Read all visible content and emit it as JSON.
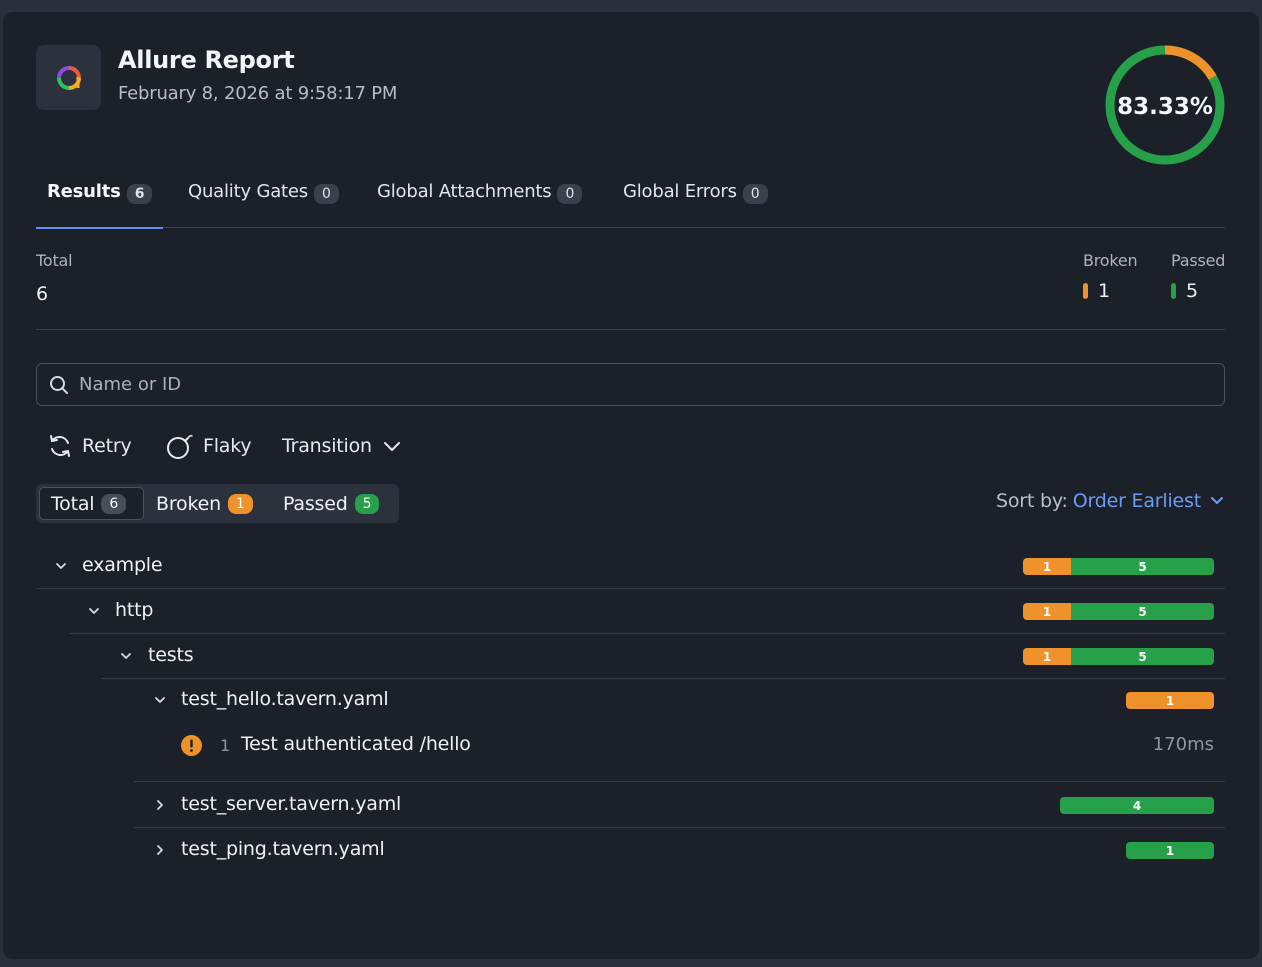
{
  "header": {
    "title": "Allure Report",
    "date": "February 8, 2026 at 9:58:17 PM",
    "success_rate": "83.33%"
  },
  "colors": {
    "broken": "#f0922b",
    "passed": "#27a04a",
    "accent": "#5b8ff0",
    "link": "#6a9df5"
  },
  "tabs": [
    {
      "label": "Results",
      "count": "6",
      "active": true
    },
    {
      "label": "Quality Gates",
      "count": "0"
    },
    {
      "label": "Global Attachments",
      "count": "0"
    },
    {
      "label": "Global Errors",
      "count": "0"
    }
  ],
  "stats": {
    "total_label": "Total",
    "total_value": "6",
    "broken_label": "Broken",
    "broken_value": "1",
    "passed_label": "Passed",
    "passed_value": "5"
  },
  "search": {
    "placeholder": "Name or ID",
    "value": ""
  },
  "filters": {
    "retry": "Retry",
    "flaky": "Flaky",
    "transition": "Transition"
  },
  "segments": [
    {
      "label": "Total",
      "count": "6",
      "active": true
    },
    {
      "label": "Broken",
      "count": "1"
    },
    {
      "label": "Passed",
      "count": "5"
    }
  ],
  "sort": {
    "label": "Sort by:",
    "value": "Order Earliest"
  },
  "tree": [
    {
      "name": "example",
      "expanded": true,
      "broken": 1,
      "passed": 5
    },
    {
      "name": "http",
      "expanded": true,
      "broken": 1,
      "passed": 5
    },
    {
      "name": "tests",
      "expanded": true,
      "broken": 1,
      "passed": 5
    },
    {
      "name": "test_hello.tavern.yaml",
      "expanded": true,
      "broken": 1,
      "passed": 0
    },
    {
      "name": "test_server.tavern.yaml",
      "expanded": false,
      "broken": 0,
      "passed": 4
    },
    {
      "name": "test_ping.tavern.yaml",
      "expanded": false,
      "broken": 0,
      "passed": 1
    }
  ],
  "test": {
    "index": "1",
    "name": "Test authenticated /hello",
    "duration": "170ms",
    "status_icon": "warning-icon"
  }
}
